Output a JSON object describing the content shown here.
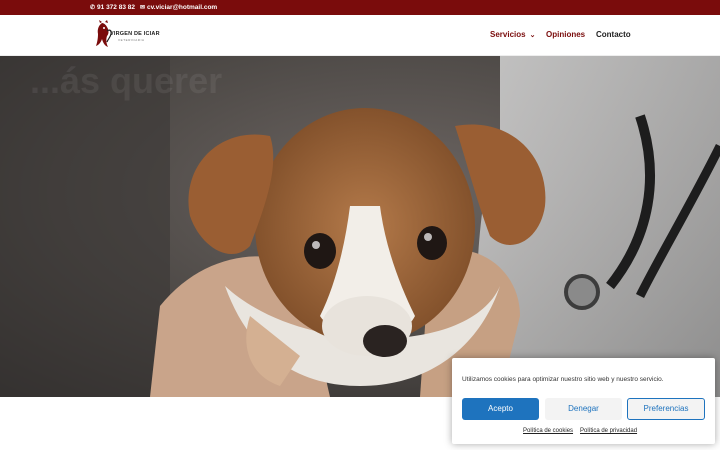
{
  "topbar": {
    "phone": "91 372 83 82",
    "email": "cv.viciar@hotmail.com",
    "phone_icon": "phone-icon",
    "email_icon": "envelope-icon"
  },
  "header": {
    "logo_text": "VIRGEN DE ICIAR",
    "logo_sub": "VETERINARIA",
    "nav": {
      "servicios": "Servicios",
      "opiniones": "Opiniones",
      "contacto": "Contacto"
    }
  },
  "hero": {
    "overlay_text": "...ás querer",
    "alt": "puppy held by veterinarian"
  },
  "cookie_banner": {
    "message": "Utilizamos cookies para optimizar nuestro sitio web y nuestro servicio.",
    "accept": "Acepto",
    "deny": "Denegar",
    "preferences": "Preferencias",
    "cookie_policy": "Política de cookies",
    "privacy_policy": "Política de privacidad"
  },
  "colors": {
    "brand": "#7a0c0c",
    "accept_button": "#1e73be",
    "button_text_blue": "#1e73be"
  }
}
